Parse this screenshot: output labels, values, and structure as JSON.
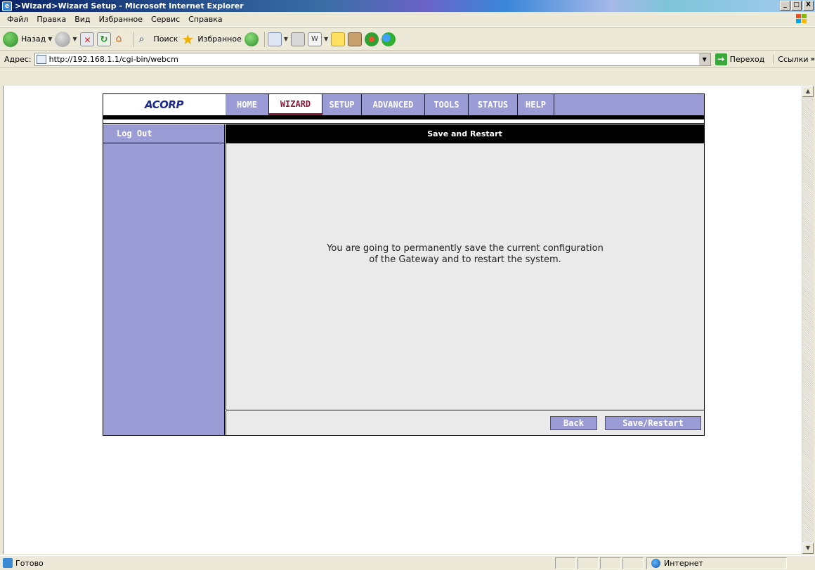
{
  "window": {
    "title": ">Wizard>Wizard Setup - Microsoft Internet Explorer",
    "controls": [
      "_",
      "□",
      "X"
    ]
  },
  "menu": [
    "Файл",
    "Правка",
    "Вид",
    "Избранное",
    "Сервис",
    "Справка"
  ],
  "toolbar": {
    "back": "Назад",
    "search": "Поиск",
    "favorites": "Избранное"
  },
  "address": {
    "label": "Адрес:",
    "url": "http://192.168.1.1/cgi-bin/webcm",
    "go": "Переход",
    "links": "Ссылки"
  },
  "router": {
    "logo": "ACORP",
    "nav": [
      "HOME",
      "WIZARD",
      "SETUP",
      "ADVANCED",
      "TOOLS",
      "STATUS",
      "HELP"
    ],
    "active_nav": "WIZARD",
    "sidebar": {
      "logout": "Log Out"
    },
    "panel": {
      "title": "Save and Restart",
      "message_line1": "You are going to permanently save the current configuration",
      "message_line2": "of the Gateway and to restart the system."
    },
    "buttons": {
      "back": "Back",
      "save": "Save/Restart"
    }
  },
  "status": {
    "text": "Готово",
    "zone": "Интернет"
  },
  "colors": {
    "nav_bg": "#9b9cd6",
    "active_nav_text": "#8a1a3a",
    "panel_bg": "#eaeaea"
  }
}
